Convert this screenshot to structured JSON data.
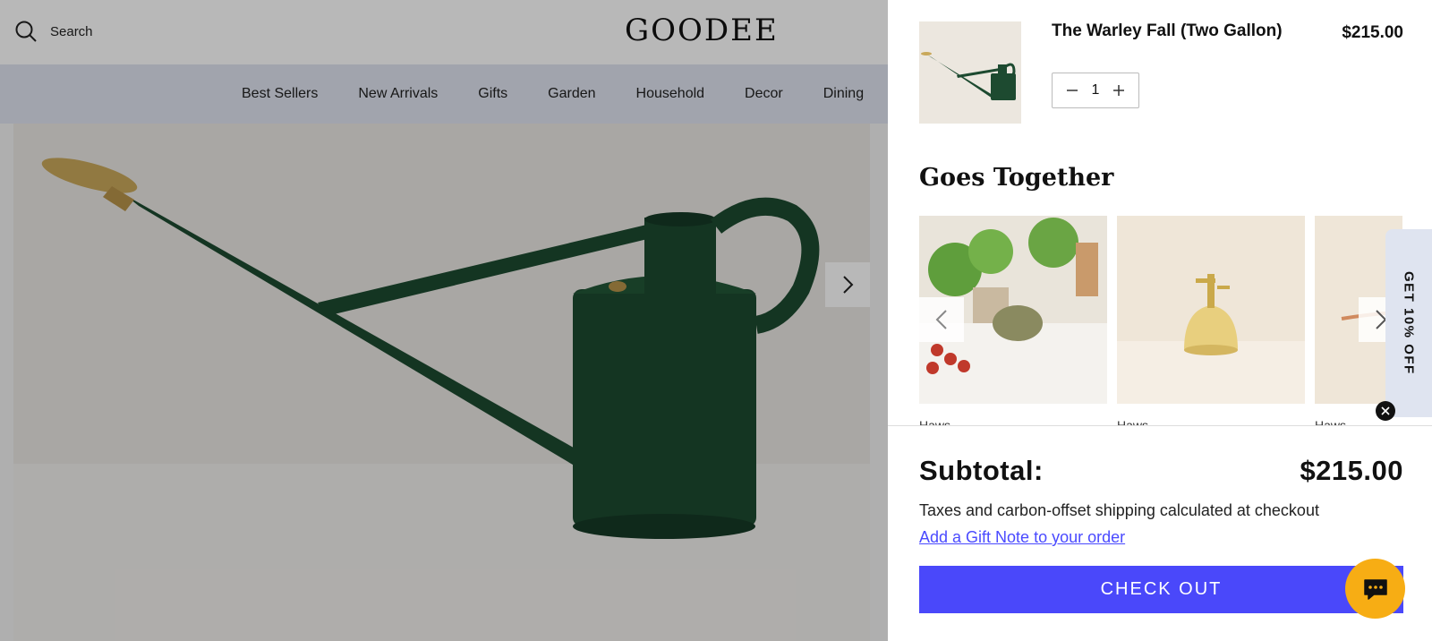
{
  "header": {
    "search_label": "Search",
    "logo": "GOODEE"
  },
  "nav": {
    "items": [
      "Best Sellers",
      "New Arrivals",
      "Gifts",
      "Garden",
      "Household",
      "Decor",
      "Dining"
    ]
  },
  "cart": {
    "item": {
      "title": "The Warley Fall (Two Gallon)",
      "price": "$215.00",
      "quantity": "1"
    },
    "goes_together": {
      "title": "Goes Together",
      "products": [
        {
          "brand": "Haws"
        },
        {
          "brand": "Haws"
        },
        {
          "brand": "Haws"
        }
      ]
    },
    "subtotal_label": "Subtotal:",
    "subtotal_value": "$215.00",
    "tax_note": "Taxes and carbon-offset shipping calculated at checkout",
    "gift_note_link": "Add a Gift Note to your order",
    "checkout_label": "CHECK OUT"
  },
  "promo": {
    "label": "GET 10% OFF"
  },
  "colors": {
    "accent": "#4a48fa",
    "chat": "#f7ad14",
    "nav_bg": "#dfe4f0",
    "product_green": "#1d4a30"
  },
  "icons": [
    "search-icon",
    "chevron-right-icon",
    "chevron-left-icon",
    "minus-icon",
    "plus-icon",
    "close-icon",
    "chat-icon"
  ]
}
